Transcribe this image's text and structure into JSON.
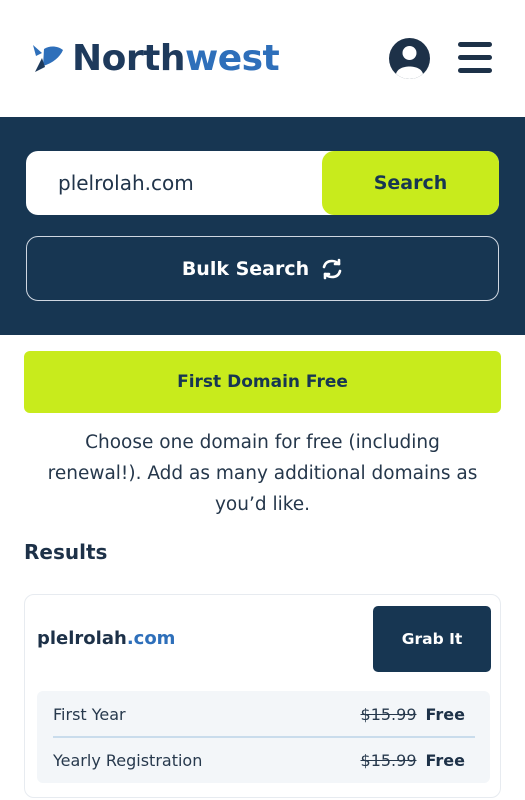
{
  "header": {
    "logo_text_main": "North",
    "logo_text_accent": "west",
    "icons": {
      "logo": "northwest-logo-mark",
      "account": "user-circle-icon",
      "menu": "hamburger-menu-icon"
    }
  },
  "search": {
    "value": "plelrolah.com",
    "button_label": "Search",
    "bulk_label": "Bulk Search",
    "bulk_icon": "sync-arrows-icon"
  },
  "promo": {
    "label": "First Domain Free",
    "description": "Choose one domain for free (including renewal!). Add as many additional domains as you’d like."
  },
  "results": {
    "title": "Results",
    "items": [
      {
        "domain_name": "plelrolah",
        "domain_tld": ".com",
        "action_label": "Grab It",
        "prices": [
          {
            "label": "First Year",
            "old_price": "$15.99",
            "new_price": "Free"
          },
          {
            "label": "Yearly Registration",
            "old_price": "$15.99",
            "new_price": "Free"
          }
        ]
      }
    ]
  },
  "colors": {
    "navy": "#173652",
    "lime": "#c8eb1c",
    "accent_blue": "#2e6fba",
    "price_bg": "#f3f6f9"
  }
}
